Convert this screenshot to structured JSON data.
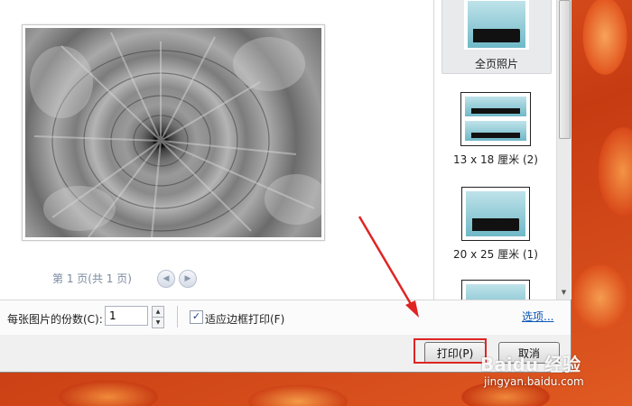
{
  "preview": {
    "page_info": "第 1 页(共 1 页)",
    "prev_icon": "chevron-left-icon",
    "next_icon": "chevron-right-icon"
  },
  "thumbnails": [
    {
      "label": "全页照片",
      "selected": true
    },
    {
      "label": "13 x 18 厘米 (2)",
      "selected": false
    },
    {
      "label": "20 x 25 厘米 (1)",
      "selected": false
    }
  ],
  "options": {
    "copies_label": "每张图片的份数(C):",
    "copies_value": "1",
    "fit_label": "适应边框打印(F)",
    "fit_checked": true,
    "options_link": "选项..."
  },
  "buttons": {
    "print": "打印(P)",
    "cancel": "取消"
  },
  "watermark": {
    "brand": "Baidu 经验",
    "url": "jingyan.baidu.com"
  },
  "colors": {
    "highlight": "#e02424",
    "link": "#0b57b8"
  }
}
